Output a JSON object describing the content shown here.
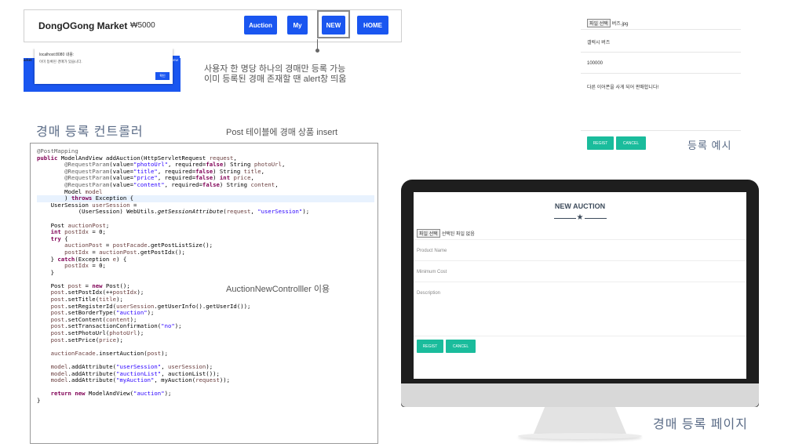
{
  "navbar": {
    "brand": "DongOGong Market",
    "balance": "₩5000",
    "buttons": [
      "Auction",
      "My",
      "NEW",
      "HOME"
    ]
  },
  "alert": {
    "host": "localhost:8080 내용:",
    "message": "이미 등록된 경매가 있습니다.",
    "ok": "확인",
    "left_fragment": "arket",
    "new_fragment": "NEW"
  },
  "note": {
    "line1": "사용자 한 명당 하나의 경매만 등록 가능",
    "line2": "이미 등록된 경매 존재할 땐 alert창 띄움"
  },
  "section": {
    "title": "경매 등록 컨트롤러",
    "subtitle": "Post 테이블에 경매 상품 insert"
  },
  "code_note": "AuctionNewControlller 이용",
  "form_example": {
    "file_button": "파일 선택",
    "file_name": "버즈.jpg",
    "title_value": "갤럭시 버즈",
    "price_value": "100000",
    "content_value": "다른 이어폰을 사게 되어 판매합니다!",
    "regist": "REGIST",
    "cancel": "CANCEL",
    "caption": "등록 예시"
  },
  "page_new_auction": {
    "title": "NEW AUCTION",
    "file_button": "파일 선택",
    "file_status": "선택된 파일 없음",
    "product_name": "Product Name",
    "minimum_cost": "Minimum Cost",
    "description": "Description",
    "regist": "REGIST",
    "cancel": "CANCEL",
    "caption": "경매 등록 페이지"
  },
  "colors": {
    "nav_button": "#1a56f0",
    "teal_button": "#1abc9c",
    "caption": "#5a6b86"
  }
}
